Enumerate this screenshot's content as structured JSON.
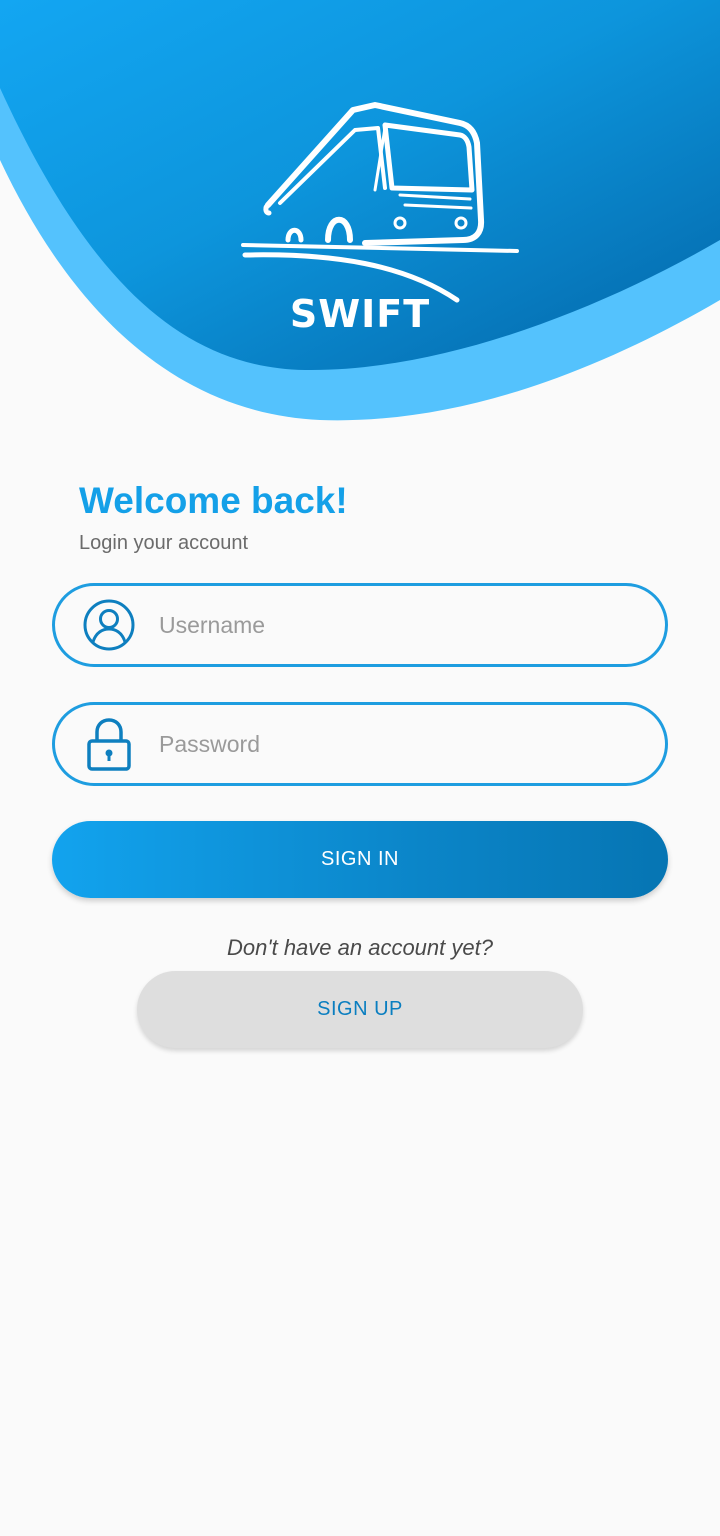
{
  "brand": {
    "name": "SWIFT",
    "logo_icon": "bus-icon"
  },
  "welcome": {
    "title": "Welcome back!",
    "subtitle": "Login your account"
  },
  "form": {
    "username": {
      "placeholder": "Username",
      "value": "",
      "icon": "user-icon"
    },
    "password": {
      "placeholder": "Password",
      "value": "",
      "icon": "lock-icon"
    },
    "signin_label": "SIGN IN"
  },
  "signup": {
    "prompt": "Don't have an account yet?",
    "button_label": "SIGN UP"
  },
  "colors": {
    "primary": "#14a0e8",
    "primary_dark": "#0675b3",
    "wave_light": "#54c2fd",
    "background": "#fafafa",
    "signup_bg": "#dedede"
  }
}
